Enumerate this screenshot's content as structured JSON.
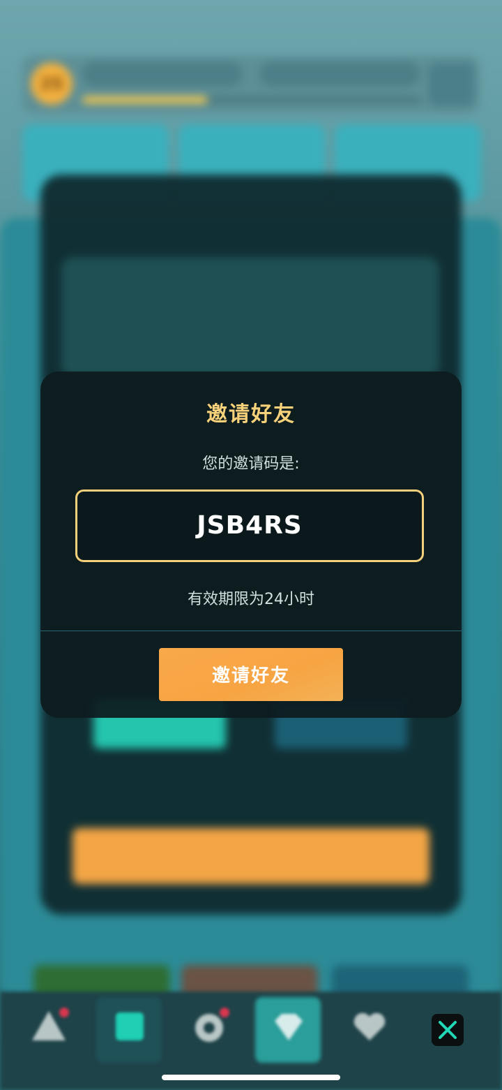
{
  "modal": {
    "title": "邀请好友",
    "prompt": "您的邀请码是:",
    "invite_code": "JSB4RS",
    "validity": "有效期限为24小时",
    "button_label": "邀请好友"
  },
  "background": {
    "player_level": "25"
  },
  "nav": {
    "items": [
      "warning-icon",
      "card-icon",
      "compass-icon",
      "diamond-icon",
      "heart-icon"
    ],
    "close_icon": "close-icon"
  },
  "colors": {
    "accent_orange": "#f7a443",
    "title_gold": "#f7d27a",
    "code_border": "#f2d07c",
    "close_x": "#21d7b6"
  }
}
